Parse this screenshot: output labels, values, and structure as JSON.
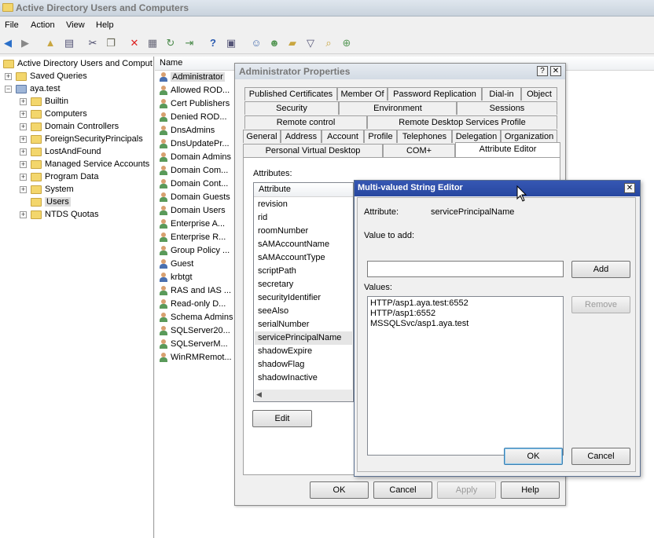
{
  "window": {
    "title": "Active Directory Users and Computers"
  },
  "menu": [
    "File",
    "Action",
    "View",
    "Help"
  ],
  "toolbar_icons": [
    "back-arrow-icon",
    "forward-arrow-icon",
    "up-folder-icon",
    "console-tree-icon",
    "cut-icon",
    "copy-icon",
    "delete-icon",
    "properties-icon",
    "refresh-icon",
    "export-icon",
    "help-icon",
    "show-hide-icon",
    "new-user-icon",
    "new-group-icon",
    "new-ou-icon",
    "filter-icon",
    "find-icon",
    "add-to-group-icon"
  ],
  "tree": {
    "root": "Active Directory Users and Comput",
    "saved_queries": "Saved Queries",
    "domain": "aya.test",
    "children": [
      "Builtin",
      "Computers",
      "Domain Controllers",
      "ForeignSecurityPrincipals",
      "LostAndFound",
      "Managed Service Accounts",
      "Program Data",
      "System",
      "Users",
      "NTDS Quotas"
    ]
  },
  "list": {
    "column_name": "Name",
    "items": [
      "Administrator",
      "Allowed ROD...",
      "Cert Publishers",
      "Denied ROD...",
      "DnsAdmins",
      "DnsUpdatePr...",
      "Domain Admins",
      "Domain Com...",
      "Domain Cont...",
      "Domain Guests",
      "Domain Users",
      "Enterprise A...",
      "Enterprise R...",
      "Group Policy ...",
      "Guest",
      "krbtgt",
      "RAS and IAS ...",
      "Read-only D...",
      "Schema Admins",
      "SQLServer20...",
      "SQLServerM...",
      "WinRMRemot..."
    ]
  },
  "props": {
    "title": "Administrator Properties",
    "help": "?",
    "close": "✕",
    "tabs_row1": [
      "Published Certificates",
      "Member Of",
      "Password Replication",
      "Dial-in",
      "Object"
    ],
    "tabs_row2": [
      "Security",
      "Environment",
      "Sessions"
    ],
    "tabs_row3": [
      "Remote control",
      "Remote Desktop Services Profile"
    ],
    "tabs_row4": [
      "General",
      "Address",
      "Account",
      "Profile",
      "Telephones",
      "Delegation",
      "Organization"
    ],
    "tabs_row5": [
      "Personal Virtual Desktop",
      "COM+",
      "Attribute Editor"
    ],
    "attributes_label": "Attributes:",
    "attr_col": "Attribute",
    "attributes": [
      "revision",
      "rid",
      "roomNumber",
      "sAMAccountName",
      "sAMAccountType",
      "scriptPath",
      "secretary",
      "securityIdentifier",
      "seeAlso",
      "serialNumber",
      "servicePrincipalName",
      "shadowExpire",
      "shadowFlag",
      "shadowInactive"
    ],
    "edit": "Edit",
    "ok": "OK",
    "cancel": "Cancel",
    "apply": "Apply",
    "help_btn": "Help"
  },
  "editor": {
    "title": "Multi-valued String Editor",
    "close": "✕",
    "attribute_label": "Attribute:",
    "attribute_value": "servicePrincipalName",
    "value_to_add_label": "Value to add:",
    "value_to_add": "",
    "add": "Add",
    "values_label": "Values:",
    "values": [
      "HTTP/asp1.aya.test:6552",
      "HTTP/asp1:6552",
      "MSSQLSvc/asp1.aya.test"
    ],
    "remove": "Remove",
    "ok": "OK",
    "cancel": "Cancel"
  }
}
